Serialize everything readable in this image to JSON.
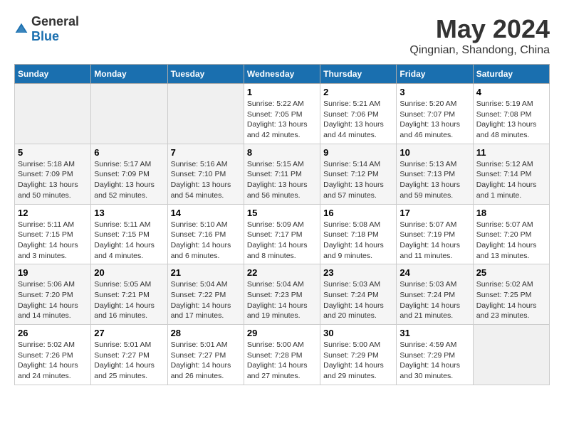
{
  "header": {
    "logo_general": "General",
    "logo_blue": "Blue",
    "month_title": "May 2024",
    "location": "Qingnian, Shandong, China"
  },
  "weekdays": [
    "Sunday",
    "Monday",
    "Tuesday",
    "Wednesday",
    "Thursday",
    "Friday",
    "Saturday"
  ],
  "weeks": [
    [
      {
        "day": "",
        "empty": true
      },
      {
        "day": "",
        "empty": true
      },
      {
        "day": "",
        "empty": true
      },
      {
        "day": "1",
        "sunrise": "5:22 AM",
        "sunset": "7:05 PM",
        "daylight": "13 hours and 42 minutes."
      },
      {
        "day": "2",
        "sunrise": "5:21 AM",
        "sunset": "7:06 PM",
        "daylight": "13 hours and 44 minutes."
      },
      {
        "day": "3",
        "sunrise": "5:20 AM",
        "sunset": "7:07 PM",
        "daylight": "13 hours and 46 minutes."
      },
      {
        "day": "4",
        "sunrise": "5:19 AM",
        "sunset": "7:08 PM",
        "daylight": "13 hours and 48 minutes."
      }
    ],
    [
      {
        "day": "5",
        "sunrise": "5:18 AM",
        "sunset": "7:09 PM",
        "daylight": "13 hours and 50 minutes."
      },
      {
        "day": "6",
        "sunrise": "5:17 AM",
        "sunset": "7:09 PM",
        "daylight": "13 hours and 52 minutes."
      },
      {
        "day": "7",
        "sunrise": "5:16 AM",
        "sunset": "7:10 PM",
        "daylight": "13 hours and 54 minutes."
      },
      {
        "day": "8",
        "sunrise": "5:15 AM",
        "sunset": "7:11 PM",
        "daylight": "13 hours and 56 minutes."
      },
      {
        "day": "9",
        "sunrise": "5:14 AM",
        "sunset": "7:12 PM",
        "daylight": "13 hours and 57 minutes."
      },
      {
        "day": "10",
        "sunrise": "5:13 AM",
        "sunset": "7:13 PM",
        "daylight": "13 hours and 59 minutes."
      },
      {
        "day": "11",
        "sunrise": "5:12 AM",
        "sunset": "7:14 PM",
        "daylight": "14 hours and 1 minute."
      }
    ],
    [
      {
        "day": "12",
        "sunrise": "5:11 AM",
        "sunset": "7:15 PM",
        "daylight": "14 hours and 3 minutes."
      },
      {
        "day": "13",
        "sunrise": "5:11 AM",
        "sunset": "7:15 PM",
        "daylight": "14 hours and 4 minutes."
      },
      {
        "day": "14",
        "sunrise": "5:10 AM",
        "sunset": "7:16 PM",
        "daylight": "14 hours and 6 minutes."
      },
      {
        "day": "15",
        "sunrise": "5:09 AM",
        "sunset": "7:17 PM",
        "daylight": "14 hours and 8 minutes."
      },
      {
        "day": "16",
        "sunrise": "5:08 AM",
        "sunset": "7:18 PM",
        "daylight": "14 hours and 9 minutes."
      },
      {
        "day": "17",
        "sunrise": "5:07 AM",
        "sunset": "7:19 PM",
        "daylight": "14 hours and 11 minutes."
      },
      {
        "day": "18",
        "sunrise": "5:07 AM",
        "sunset": "7:20 PM",
        "daylight": "14 hours and 13 minutes."
      }
    ],
    [
      {
        "day": "19",
        "sunrise": "5:06 AM",
        "sunset": "7:20 PM",
        "daylight": "14 hours and 14 minutes."
      },
      {
        "day": "20",
        "sunrise": "5:05 AM",
        "sunset": "7:21 PM",
        "daylight": "14 hours and 16 minutes."
      },
      {
        "day": "21",
        "sunrise": "5:04 AM",
        "sunset": "7:22 PM",
        "daylight": "14 hours and 17 minutes."
      },
      {
        "day": "22",
        "sunrise": "5:04 AM",
        "sunset": "7:23 PM",
        "daylight": "14 hours and 19 minutes."
      },
      {
        "day": "23",
        "sunrise": "5:03 AM",
        "sunset": "7:24 PM",
        "daylight": "14 hours and 20 minutes."
      },
      {
        "day": "24",
        "sunrise": "5:03 AM",
        "sunset": "7:24 PM",
        "daylight": "14 hours and 21 minutes."
      },
      {
        "day": "25",
        "sunrise": "5:02 AM",
        "sunset": "7:25 PM",
        "daylight": "14 hours and 23 minutes."
      }
    ],
    [
      {
        "day": "26",
        "sunrise": "5:02 AM",
        "sunset": "7:26 PM",
        "daylight": "14 hours and 24 minutes."
      },
      {
        "day": "27",
        "sunrise": "5:01 AM",
        "sunset": "7:27 PM",
        "daylight": "14 hours and 25 minutes."
      },
      {
        "day": "28",
        "sunrise": "5:01 AM",
        "sunset": "7:27 PM",
        "daylight": "14 hours and 26 minutes."
      },
      {
        "day": "29",
        "sunrise": "5:00 AM",
        "sunset": "7:28 PM",
        "daylight": "14 hours and 27 minutes."
      },
      {
        "day": "30",
        "sunrise": "5:00 AM",
        "sunset": "7:29 PM",
        "daylight": "14 hours and 29 minutes."
      },
      {
        "day": "31",
        "sunrise": "4:59 AM",
        "sunset": "7:29 PM",
        "daylight": "14 hours and 30 minutes."
      },
      {
        "day": "",
        "empty": true
      }
    ]
  ],
  "labels": {
    "sunrise": "Sunrise: ",
    "sunset": "Sunset: ",
    "daylight": "Daylight: "
  }
}
